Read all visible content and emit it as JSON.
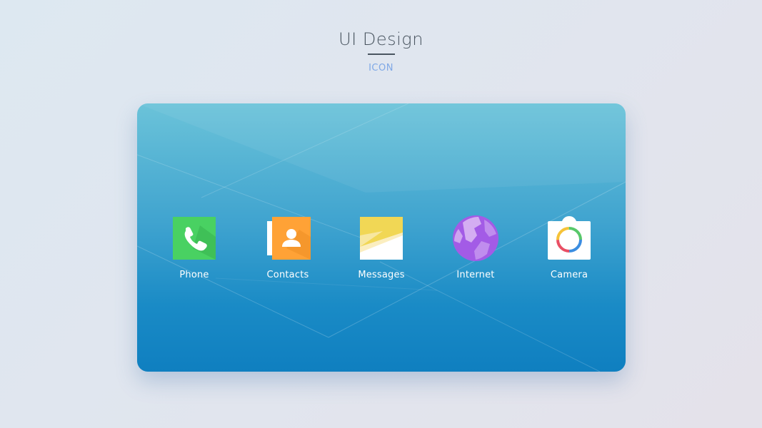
{
  "header": {
    "title": "UI Design",
    "subtitle": "ICON"
  },
  "apps": [
    {
      "label": "Phone",
      "icon": "phone-icon",
      "color": "#4cd465"
    },
    {
      "label": "Contacts",
      "icon": "contacts-icon",
      "color": "#ffa33a"
    },
    {
      "label": "Messages",
      "icon": "messages-icon",
      "color": "#f0d655"
    },
    {
      "label": "Internet",
      "icon": "internet-icon",
      "color": "#9c4fe3"
    },
    {
      "label": "Camera",
      "icon": "camera-icon",
      "color": "#ffffff"
    }
  ],
  "colors": {
    "card_top": "#6bc3d9",
    "card_bottom": "#0f7fc0",
    "title": "#4a5560",
    "subtitle": "#7fa8e6"
  }
}
